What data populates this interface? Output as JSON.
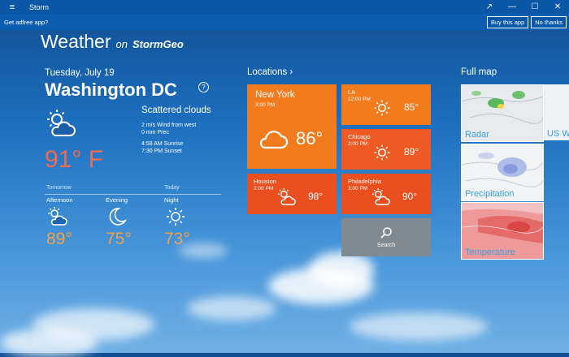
{
  "window": {
    "title": "Storm",
    "menu_icon": "hamburger-icon",
    "controls": [
      "↗",
      "—",
      "☐",
      "✕"
    ]
  },
  "adbar": {
    "text": "Get adfree app?",
    "buy_label": "Buy this app",
    "no_label": "No thanks"
  },
  "header": {
    "title": "Weather",
    "on": "on",
    "brand": "StormGeo"
  },
  "current": {
    "date": "Tuesday, July 19",
    "city": "Washington DC",
    "help": "?",
    "condition": "Scattered clouds",
    "wind": "2 m/s Wind from west",
    "precip": "0 mm Prec",
    "sunrise": "4:58 AM Sunrise",
    "sunset": "7:30 PM Sunset",
    "temp": "91° F"
  },
  "forecast": {
    "tomorrow_label": "Tomorrow",
    "today_label": "Today",
    "items": [
      {
        "label": "Afternoon",
        "temp": "89°",
        "icon": "partly-cloudy-icon"
      },
      {
        "label": "Evening",
        "temp": "75°",
        "icon": "moon-icon"
      },
      {
        "label": "Night",
        "temp": "73°",
        "icon": "sun-icon"
      }
    ]
  },
  "locations": {
    "heading": "Locations ›",
    "tiles": [
      {
        "name": "New York",
        "time": "3:00 PM",
        "temp": "86°",
        "color": "#f27b1d",
        "icon": "cloud-icon"
      },
      {
        "name": "LA",
        "time": "12:00 PM",
        "temp": "85°",
        "color": "#f27b1d",
        "icon": "sun-icon"
      },
      {
        "name": "Chicago",
        "time": "2:00 PM",
        "temp": "89°",
        "color": "#ee5a24",
        "icon": "sun-icon"
      },
      {
        "name": "Houston",
        "time": "2:00 PM",
        "temp": "98°",
        "color": "#ea4f1f",
        "icon": "partly-cloudy-icon"
      },
      {
        "name": "Philadelphia",
        "time": "3:00 PM",
        "temp": "90°",
        "color": "#ea4f1f",
        "icon": "partly-cloudy-icon"
      }
    ],
    "search_label": "Search"
  },
  "maps": {
    "heading": "Full map",
    "items": [
      {
        "label": "Radar"
      },
      {
        "label": "Precipitation"
      },
      {
        "label": "Temperature"
      }
    ],
    "partial_label": "US W"
  }
}
